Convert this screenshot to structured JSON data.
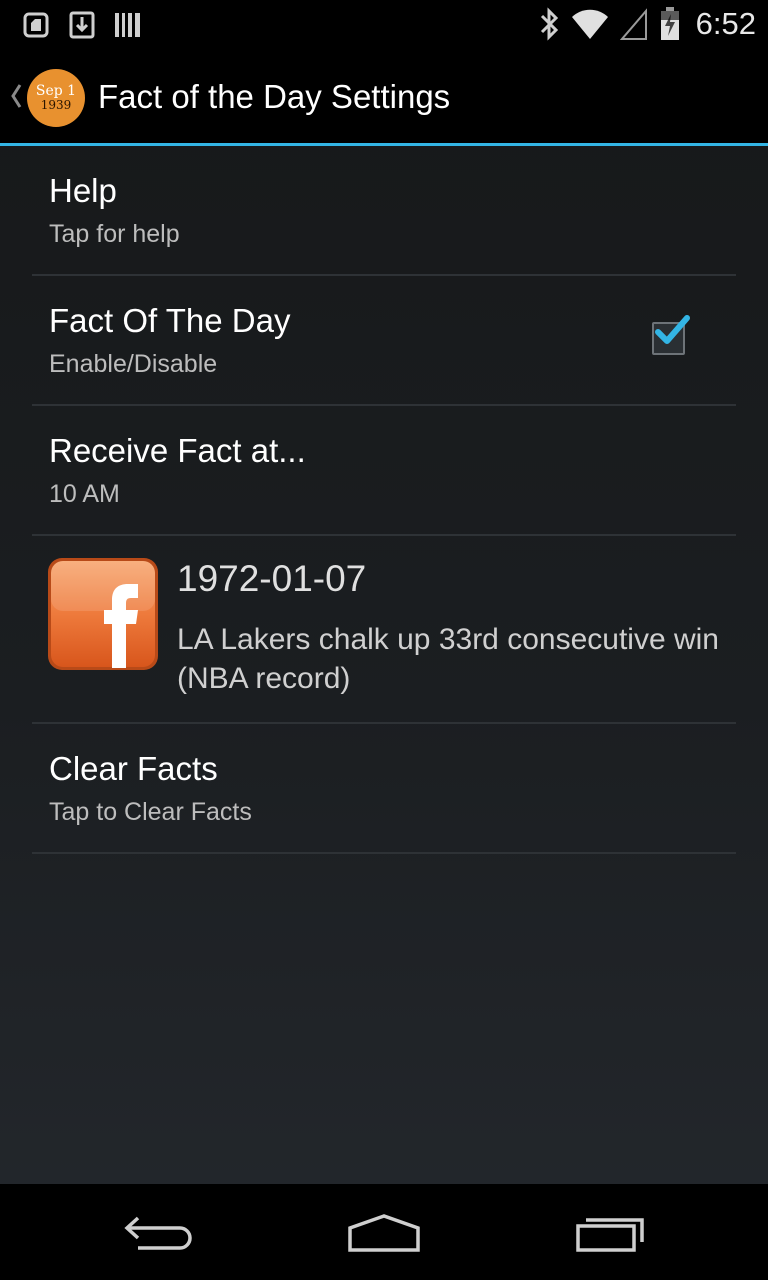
{
  "status_bar": {
    "time": "6:52",
    "left_icons": [
      "sd-card-icon",
      "download-icon",
      "barcode-icon"
    ],
    "right_icons": [
      "bluetooth-icon",
      "wifi-icon",
      "signal-icon",
      "battery-icon"
    ]
  },
  "action_bar": {
    "title": "Fact of the Day Settings",
    "logo_line1": "Sep 1",
    "logo_line2": "1939",
    "logo_color": "#e8912f"
  },
  "preferences": {
    "help": {
      "title": "Help",
      "summary": "Tap for help"
    },
    "fact_of_the_day": {
      "title": "Fact Of The Day",
      "summary": "Enable/Disable",
      "checked": true
    },
    "receive_time": {
      "title": "Receive Fact at...",
      "summary": "10 AM"
    },
    "fact": {
      "date": "1972-01-07",
      "text": "LA Lakers chalk up 33rd consecutive win (NBA record)",
      "icon": "facebook-icon"
    },
    "clear_facts": {
      "title": "Clear Facts",
      "summary": "Tap to Clear Facts"
    }
  },
  "colors": {
    "accent": "#33b5e5",
    "divider": "#2e3236",
    "background": "#1b1e21"
  },
  "nav_bar": {
    "icons": [
      "back-icon",
      "home-icon",
      "recent-apps-icon"
    ]
  }
}
